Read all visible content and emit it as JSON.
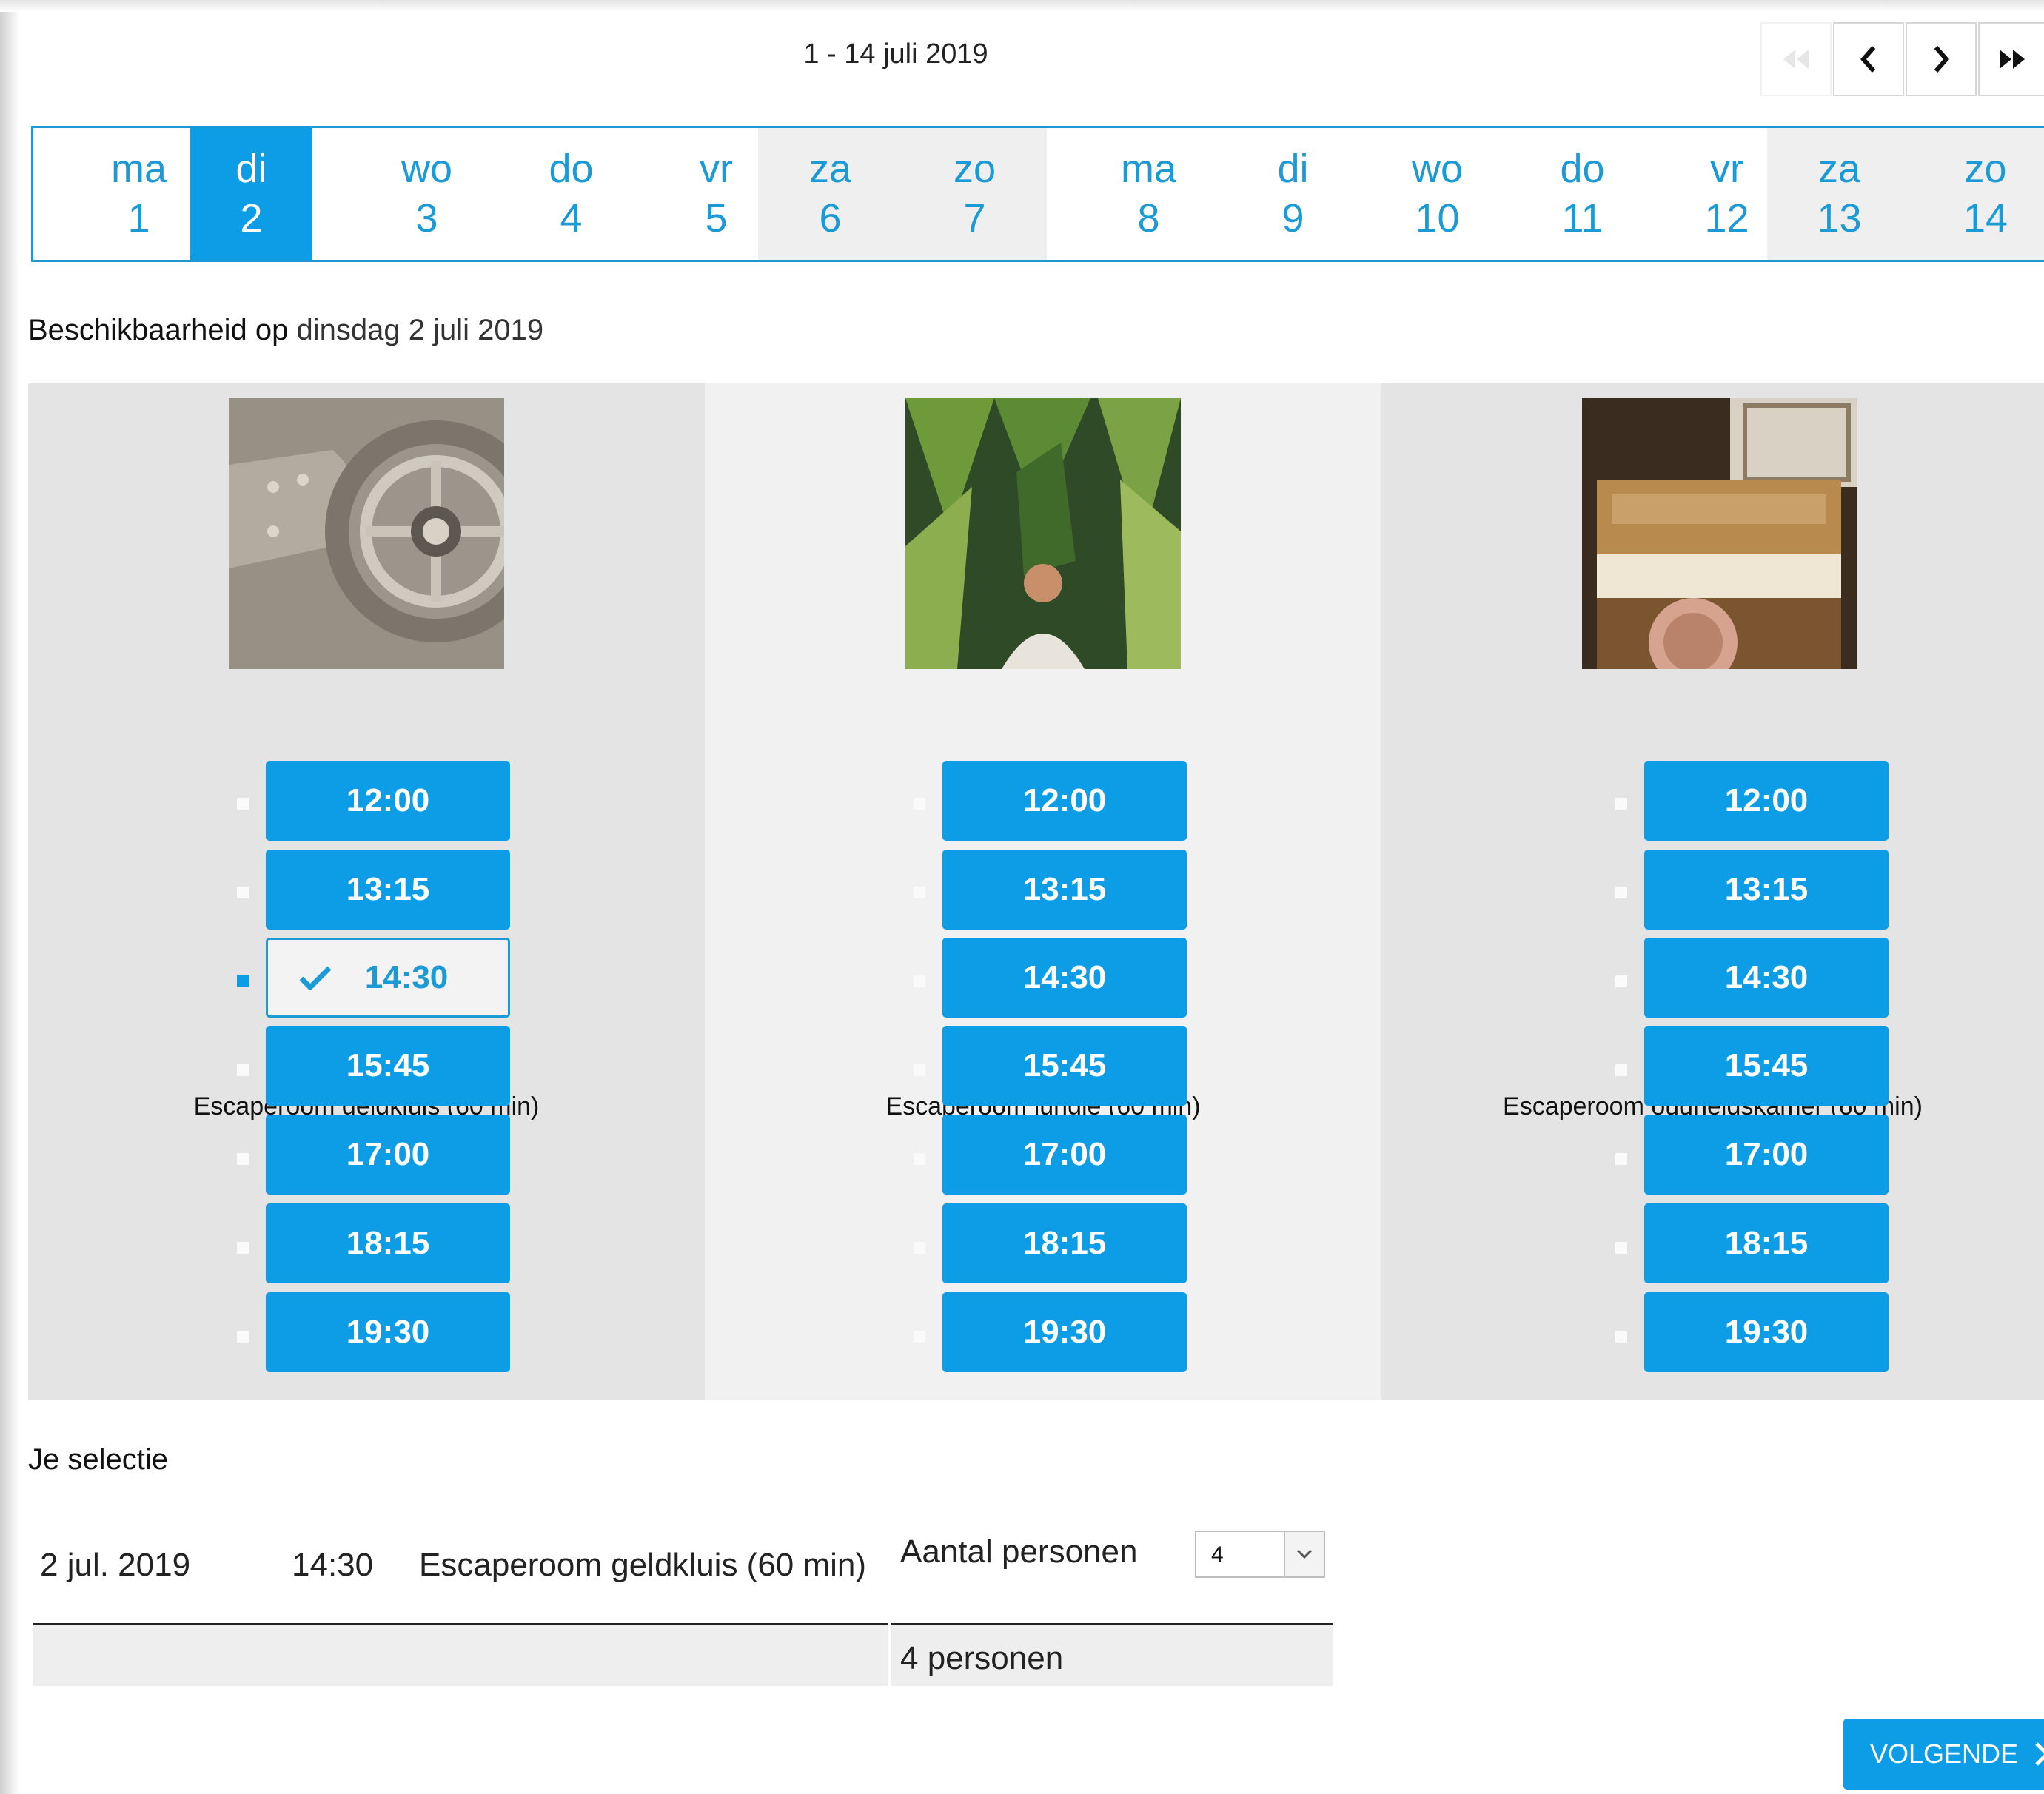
{
  "header": {
    "range_title": "1 - 14 juli 2019",
    "nav": [
      "first-page-icon",
      "prev-icon",
      "next-icon",
      "last-page-icon"
    ]
  },
  "calendar": {
    "days": [
      {
        "name": "ma",
        "num": "1"
      },
      {
        "name": "di",
        "num": "2"
      },
      {
        "name": "wo",
        "num": "3"
      },
      {
        "name": "do",
        "num": "4"
      },
      {
        "name": "vr",
        "num": "5"
      },
      {
        "name": "za",
        "num": "6"
      },
      {
        "name": "zo",
        "num": "7"
      },
      {
        "name": "ma",
        "num": "8"
      },
      {
        "name": "di",
        "num": "9"
      },
      {
        "name": "wo",
        "num": "10"
      },
      {
        "name": "do",
        "num": "11"
      },
      {
        "name": "vr",
        "num": "12"
      },
      {
        "name": "za",
        "num": "13"
      },
      {
        "name": "zo",
        "num": "14"
      }
    ],
    "selected_index": 1,
    "accent": "#0c9de6"
  },
  "availability": {
    "label": "Beschikbaarheid op",
    "date": "dinsdag 2 juli 2019"
  },
  "rooms": [
    {
      "title": "Escaperoom geldkluis (60 min)",
      "image": "vault-door-image",
      "slots": [
        "12:00",
        "13:15",
        "14:30",
        "15:45",
        "17:00",
        "18:15",
        "19:30"
      ],
      "selected_slot": 2
    },
    {
      "title": "Escaperoom jungle (60 min)",
      "image": "jungle-image",
      "slots": [
        "12:00",
        "13:15",
        "14:30",
        "15:45",
        "17:00",
        "18:15",
        "19:30"
      ],
      "selected_slot": -1
    },
    {
      "title": "Escaperoom oudheidskamer (60 min)",
      "image": "antique-piano-image",
      "slots": [
        "12:00",
        "13:15",
        "14:30",
        "15:45",
        "17:00",
        "18:15",
        "19:30"
      ],
      "selected_slot": -1
    }
  ],
  "selection": {
    "title": "Je selectie",
    "date": "2 jul. 2019",
    "time": "14:30",
    "room": "Escaperoom geldkluis (60 min)",
    "persons_label": "Aantal personen",
    "persons_value": "4",
    "summary": "4 personen"
  },
  "footer": {
    "next_label": "VOLGENDE"
  }
}
